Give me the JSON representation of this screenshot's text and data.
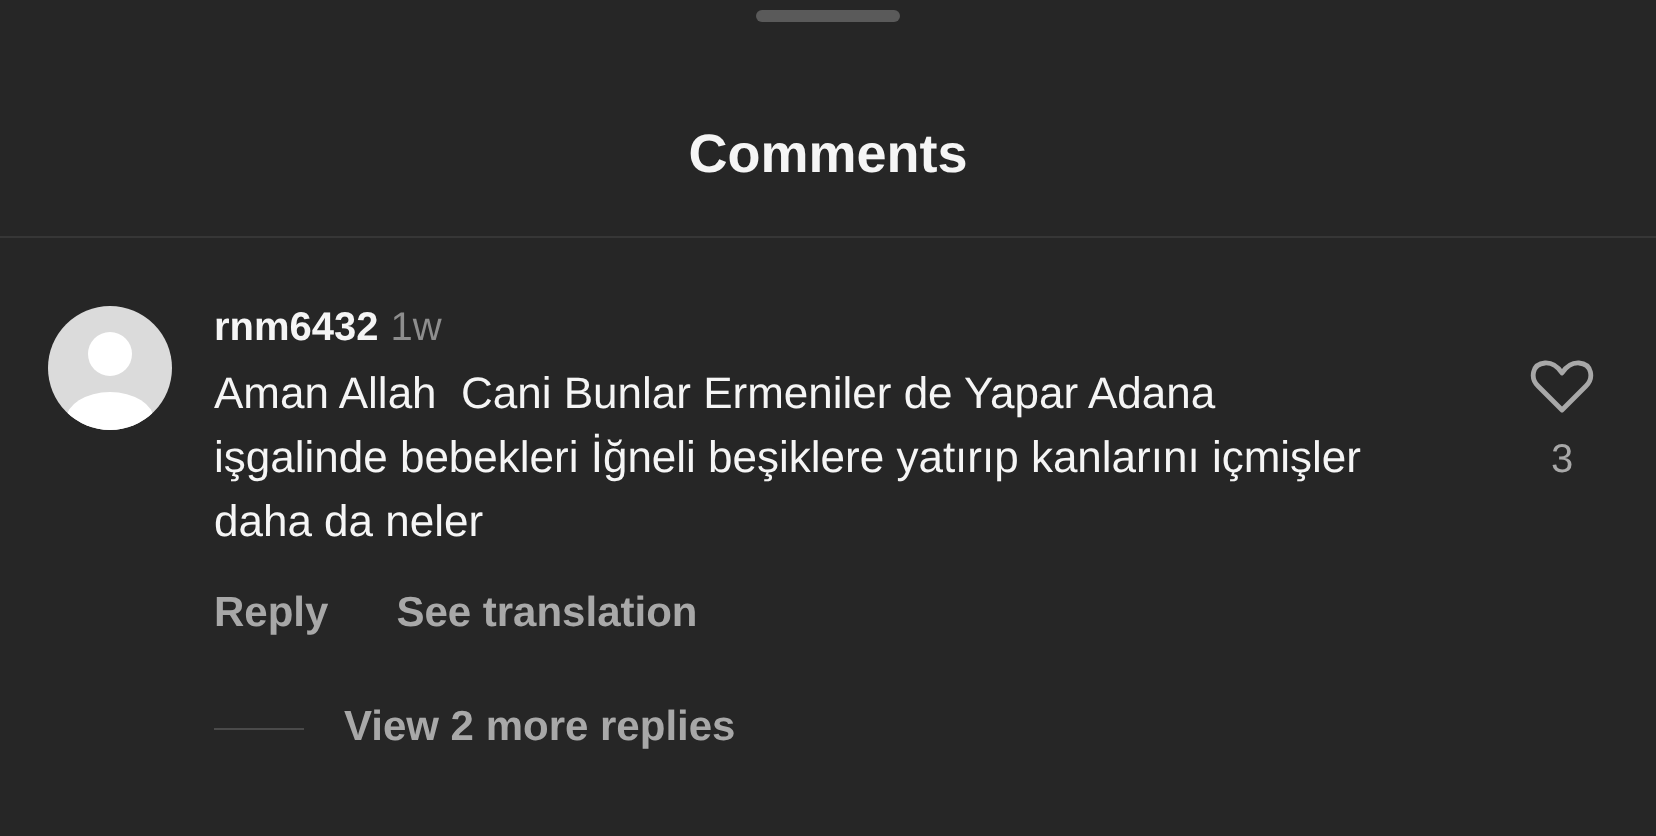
{
  "sheet": {
    "title": "Comments"
  },
  "comments": [
    {
      "username": "rnm6432",
      "time": "1w",
      "text": "Aman Allah  Cani Bunlar Ermeniler de Yapar Adana işgalinde bebekleri İğneli beşiklere yatırıp kanlarını içmişler daha da neler",
      "liked": false,
      "like_count": "3",
      "actions": [
        "Reply",
        "See translation"
      ],
      "more_replies": "View 2 more replies"
    }
  ]
}
